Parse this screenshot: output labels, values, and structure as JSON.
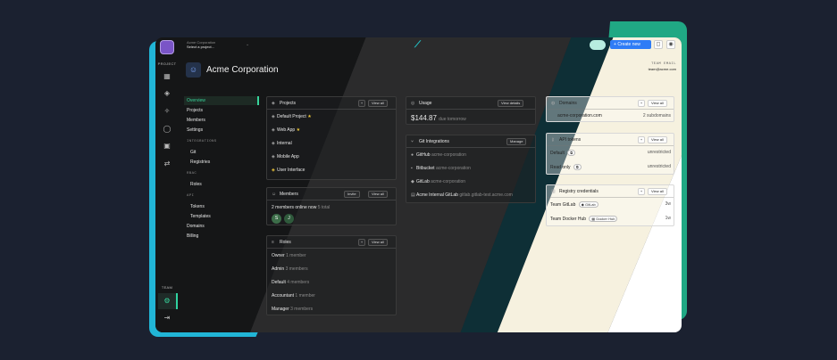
{
  "topbar": {
    "org": "Acme Corporation",
    "project_placeholder": "Select a project...",
    "create_new": "Create new"
  },
  "rail": {
    "project_label": "PROJECT",
    "team_label": "TEAM"
  },
  "header": {
    "title": "Acme Corporation",
    "team_email_label": "TEAM EMAIL",
    "team_email": "team@acme.com"
  },
  "nav": {
    "items": [
      "Overview",
      "Projects",
      "Members",
      "Settings"
    ],
    "integrations_label": "INTEGRATIONS",
    "integrations": [
      "Git",
      "Registries"
    ],
    "rbac_label": "RBAC",
    "rbac": [
      "Roles"
    ],
    "api_label": "API",
    "api": [
      "Tokens",
      "Templates"
    ],
    "bottom": [
      "Domains",
      "Billing"
    ]
  },
  "projects_card": {
    "title": "Projects",
    "view_all": "View all",
    "items": [
      "Default Project",
      "Web App",
      "Internal",
      "Mobile App",
      "User Interface"
    ]
  },
  "members_card": {
    "title": "Members",
    "invite": "Invite",
    "view_all": "View all",
    "online": "2 members online now",
    "total": "5 total",
    "avatars": [
      "S",
      "J"
    ]
  },
  "roles_card": {
    "title": "Roles",
    "view_all": "View all",
    "items": [
      {
        "name": "Owner",
        "count": "1 member"
      },
      {
        "name": "Admin",
        "count": "3 members"
      },
      {
        "name": "Default",
        "count": "4 members"
      },
      {
        "name": "Accountant",
        "count": "1 member"
      },
      {
        "name": "Manager",
        "count": "3 members"
      }
    ]
  },
  "usage_card": {
    "title": "Usage",
    "view_details": "View details",
    "amount": "$144.87",
    "due": "due tomorrow"
  },
  "git_card": {
    "title": "Git Integrations",
    "manage": "Manage",
    "items": [
      {
        "name": "GitHub",
        "org": "acme-corporation"
      },
      {
        "name": "Bitbucket",
        "org": "acme-corporation"
      },
      {
        "name": "GitLab",
        "org": "acme-corporation"
      },
      {
        "name": "Acme Internal GitLab",
        "org": "gitlab.gitlab-test.acme.com"
      }
    ]
  },
  "domains_card": {
    "title": "Domains",
    "view_all": "View all",
    "domain": "acme-corporation.com",
    "subdomains": "2 subdomains"
  },
  "tokens_card": {
    "title": "API tokens",
    "view_all": "View all",
    "items": [
      {
        "name": "Default",
        "scope": "unrestricted"
      },
      {
        "name": "Read only",
        "scope": "unrestricted"
      }
    ]
  },
  "registry_card": {
    "title": "Registry credentials",
    "view_all": "View all",
    "items": [
      {
        "name": "Team GitLab",
        "tag": "GitLab",
        "age": "3w"
      },
      {
        "name": "Team Docker Hub",
        "tag": "Docker Hub",
        "age": "1w"
      }
    ]
  },
  "icons": {
    "logo": "logo-icon",
    "dashboard": "dashboard-icon",
    "layers": "layers-icon",
    "runner": "runner-icon",
    "chat": "chat-icon",
    "lock": "lock-icon",
    "shuffle": "shuffle-icon",
    "settings": "gear-icon",
    "logout": "logout-icon"
  },
  "colors": {
    "accent": "#37d39b",
    "primary_button": "#2f7cf6",
    "back_cyan": "#21b5d6",
    "back_green": "#20a884"
  }
}
